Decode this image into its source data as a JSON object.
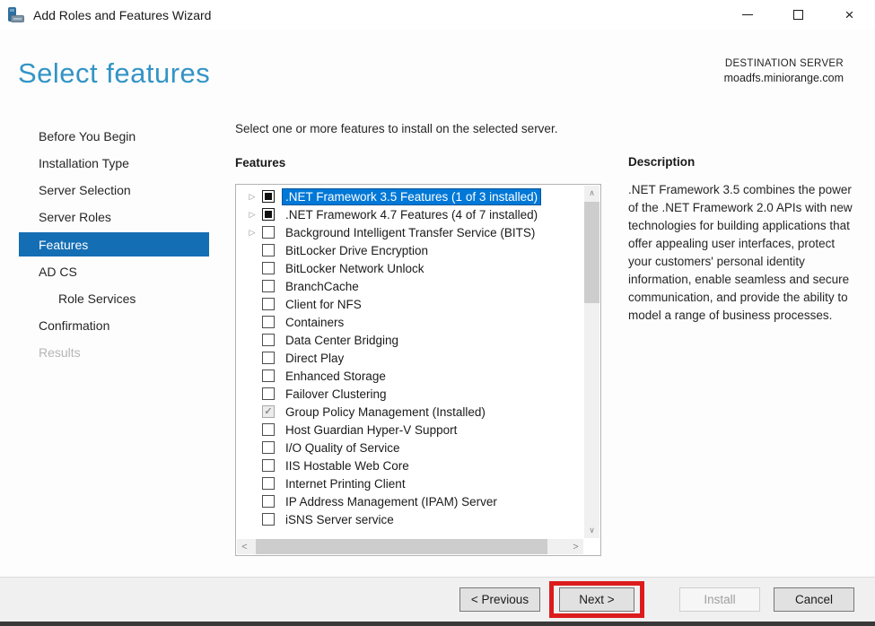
{
  "window": {
    "title": "Add Roles and Features Wizard",
    "close_glyph": "×"
  },
  "header": {
    "page_title": "Select features",
    "destination_label": "DESTINATION SERVER",
    "destination_server": "moadfs.miniorange.com"
  },
  "sidebar": {
    "items": [
      {
        "label": "Before You Begin",
        "state": "normal",
        "indent": false
      },
      {
        "label": "Installation Type",
        "state": "normal",
        "indent": false
      },
      {
        "label": "Server Selection",
        "state": "normal",
        "indent": false
      },
      {
        "label": "Server Roles",
        "state": "normal",
        "indent": false
      },
      {
        "label": "Features",
        "state": "selected",
        "indent": false
      },
      {
        "label": "AD CS",
        "state": "normal",
        "indent": false
      },
      {
        "label": "Role Services",
        "state": "normal",
        "indent": true
      },
      {
        "label": "Confirmation",
        "state": "normal",
        "indent": false
      },
      {
        "label": "Results",
        "state": "disabled",
        "indent": false
      }
    ]
  },
  "main": {
    "instruction": "Select one or more features to install on the selected server.",
    "features_label": "Features",
    "features": [
      {
        "label": ".NET Framework 3.5 Features (1 of 3 installed)",
        "checkbox": "indeterminate",
        "expander": true,
        "selected": true
      },
      {
        "label": ".NET Framework 4.7 Features (4 of 7 installed)",
        "checkbox": "indeterminate",
        "expander": true,
        "selected": false
      },
      {
        "label": "Background Intelligent Transfer Service (BITS)",
        "checkbox": "unchecked",
        "expander": true,
        "selected": false
      },
      {
        "label": "BitLocker Drive Encryption",
        "checkbox": "unchecked",
        "expander": false,
        "selected": false
      },
      {
        "label": "BitLocker Network Unlock",
        "checkbox": "unchecked",
        "expander": false,
        "selected": false
      },
      {
        "label": "BranchCache",
        "checkbox": "unchecked",
        "expander": false,
        "selected": false
      },
      {
        "label": "Client for NFS",
        "checkbox": "unchecked",
        "expander": false,
        "selected": false
      },
      {
        "label": "Containers",
        "checkbox": "unchecked",
        "expander": false,
        "selected": false
      },
      {
        "label": "Data Center Bridging",
        "checkbox": "unchecked",
        "expander": false,
        "selected": false
      },
      {
        "label": "Direct Play",
        "checkbox": "unchecked",
        "expander": false,
        "selected": false
      },
      {
        "label": "Enhanced Storage",
        "checkbox": "unchecked",
        "expander": false,
        "selected": false
      },
      {
        "label": "Failover Clustering",
        "checkbox": "unchecked",
        "expander": false,
        "selected": false
      },
      {
        "label": "Group Policy Management (Installed)",
        "checkbox": "checked-disabled",
        "expander": false,
        "selected": false
      },
      {
        "label": "Host Guardian Hyper-V Support",
        "checkbox": "unchecked",
        "expander": false,
        "selected": false
      },
      {
        "label": "I/O Quality of Service",
        "checkbox": "unchecked",
        "expander": false,
        "selected": false
      },
      {
        "label": "IIS Hostable Web Core",
        "checkbox": "unchecked",
        "expander": false,
        "selected": false
      },
      {
        "label": "Internet Printing Client",
        "checkbox": "unchecked",
        "expander": false,
        "selected": false
      },
      {
        "label": "IP Address Management (IPAM) Server",
        "checkbox": "unchecked",
        "expander": false,
        "selected": false
      },
      {
        "label": "iSNS Server service",
        "checkbox": "unchecked",
        "expander": false,
        "selected": false
      }
    ],
    "expander_glyph": "▷",
    "check_glyph": "✓",
    "scrollbar": {
      "up": "∧",
      "down": "∨",
      "left": "<",
      "right": ">"
    }
  },
  "description": {
    "heading": "Description",
    "text": ".NET Framework 3.5 combines the power of the .NET Framework 2.0 APIs with new technologies for building applications that offer appealing user interfaces, protect your customers' personal identity information, enable seamless and secure communication, and provide the ability to model a range of business processes."
  },
  "footer": {
    "previous_label": "< Previous",
    "next_label": "Next >",
    "install_label": "Install",
    "cancel_label": "Cancel"
  },
  "colors": {
    "accent_heading": "#3394c6",
    "sidebar_selected": "#146eb4",
    "tree_selection": "#0078d7",
    "annotation_red": "#dc1c1c"
  }
}
